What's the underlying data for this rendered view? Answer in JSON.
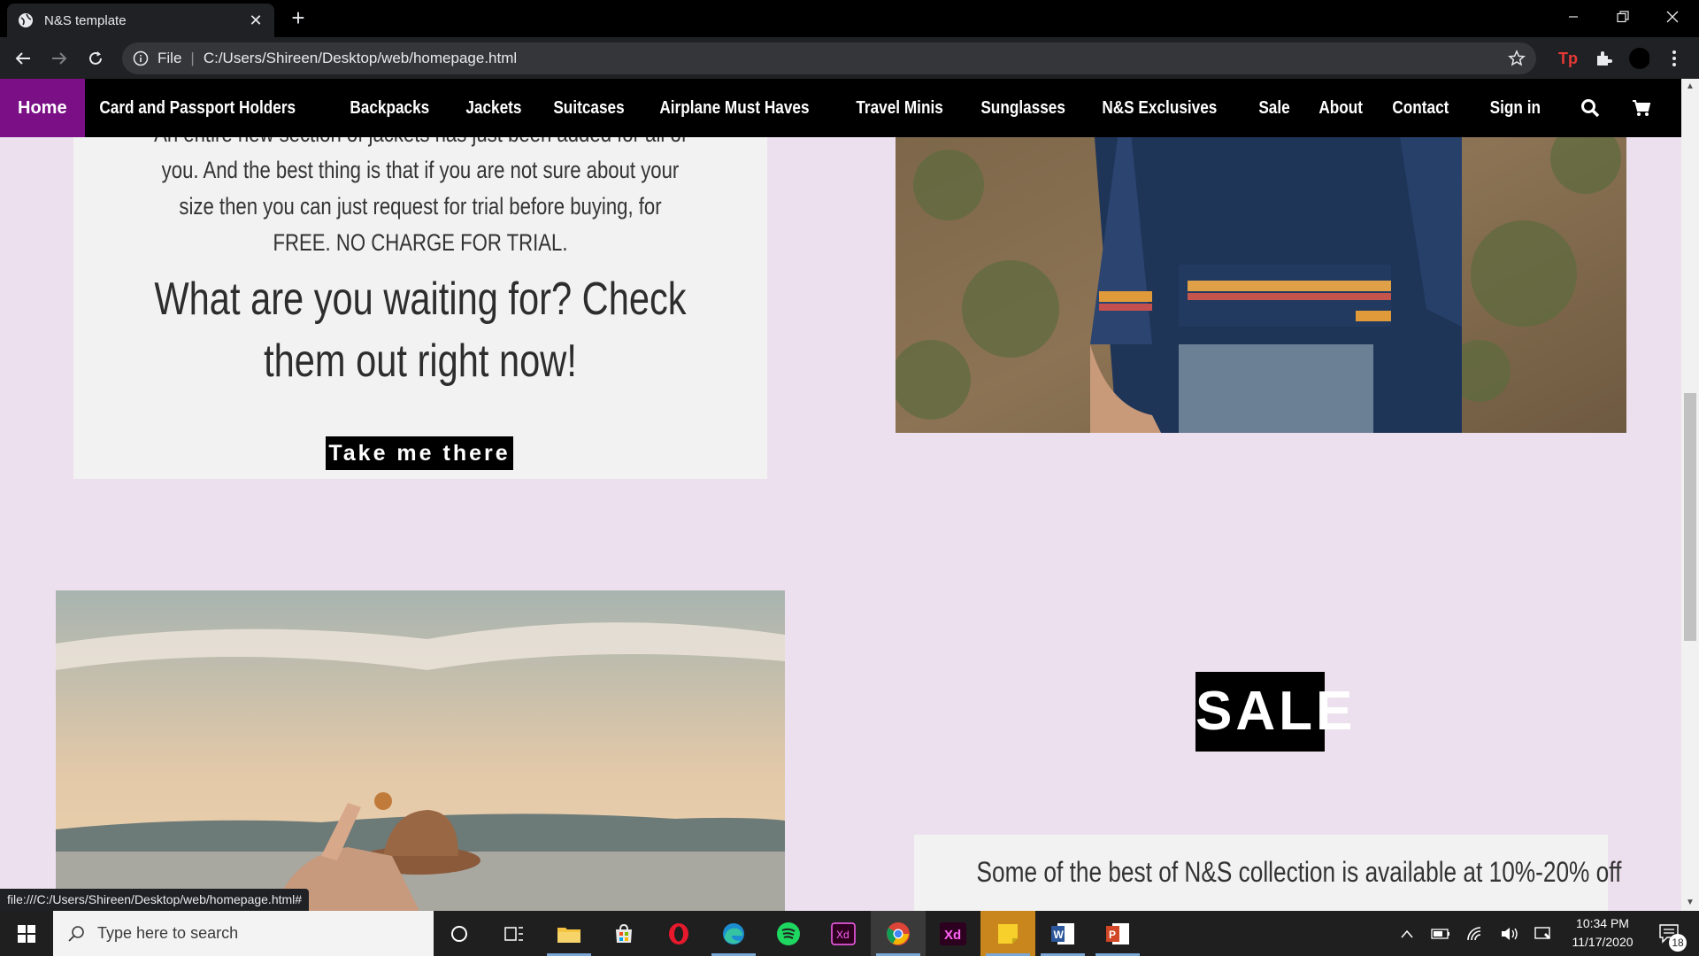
{
  "browser": {
    "tab_title": "N&S template",
    "omnibox_scheme": "File",
    "omnibox_url": "C:/Users/Shireen/Desktop/web/homepage.html",
    "status_url": "file:///C:/Users/Shireen/Desktop/web/homepage.html#"
  },
  "sitenav": {
    "items": [
      {
        "label": "Home"
      },
      {
        "label": "Card and Passport Holders"
      },
      {
        "label": "Backpacks"
      },
      {
        "label": "Jackets"
      },
      {
        "label": "Suitcases"
      },
      {
        "label": "Airplane Must Haves"
      },
      {
        "label": "Travel Minis"
      },
      {
        "label": "Sunglasses"
      },
      {
        "label": "N&S Exclusives"
      },
      {
        "label": "Sale"
      },
      {
        "label": "About"
      },
      {
        "label": "Contact"
      }
    ],
    "signin_label": "Sign in",
    "active_color": "#7a0f86"
  },
  "jackets_card": {
    "paragraph": "An entire new section of jackets has just been added for all of you. And the best thing is that if you are not sure about your size then you can just request for trial before buying, for FREE. NO CHARGE FOR TRIAL.",
    "cta_heading": "What are you waiting for? Check them out right now!",
    "cta_button": "Take me there"
  },
  "sale_section": {
    "badge": "SALE",
    "paragraph": "Some of the best of N&S collection is available at 10%-20% off"
  },
  "taskbar": {
    "search_placeholder": "Type here to search",
    "time": "10:34 PM",
    "date": "11/17/2020",
    "notification_count": "18"
  },
  "colors": {
    "page_bg": "#ede0ee",
    "card_bg": "#f2f2f2",
    "nav_bg": "#000000"
  }
}
